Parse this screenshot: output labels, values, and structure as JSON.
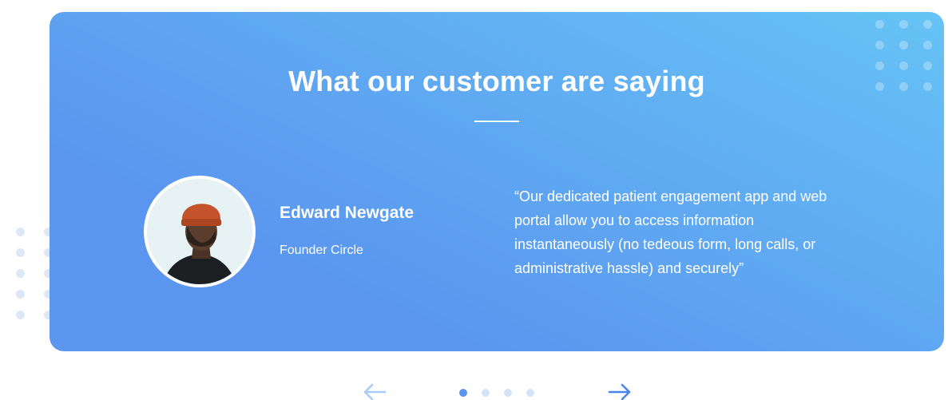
{
  "testimonials": {
    "heading": "What our customer are saying",
    "current": {
      "name": "Edward Newgate",
      "role": "Founder Circle",
      "quote": "“Our dedicated patient engagement app and web portal allow you to access information instantaneously (no tedeous form, long calls, or administrative hassle) and securely”"
    },
    "pagination": {
      "total": 4,
      "active_index": 0
    },
    "prev_icon": "arrow-left-icon",
    "next_icon": "arrow-right-icon"
  },
  "colors": {
    "card_gradient_start": "#66c3f5",
    "card_gradient_end": "#5a95ef",
    "accent": "#4a86e8",
    "inactive_dot": "#d3e3f8"
  }
}
